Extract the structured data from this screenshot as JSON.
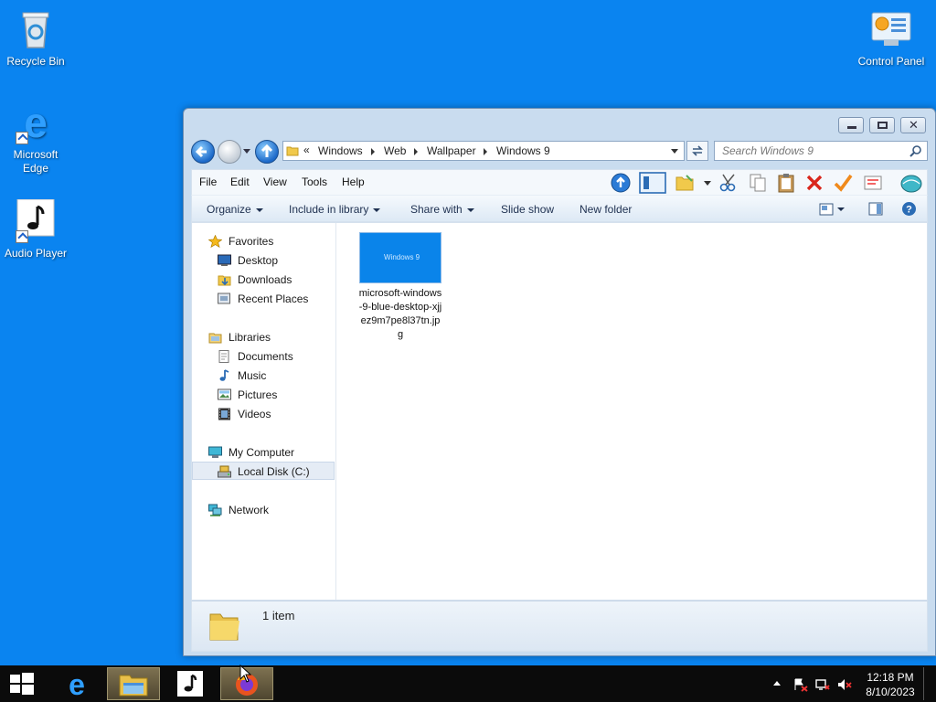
{
  "desktop": {
    "icons": [
      {
        "label": "Recycle Bin"
      },
      {
        "label": "Microsoft Edge"
      },
      {
        "label": "Audio Player"
      },
      {
        "label": "Control Panel"
      }
    ]
  },
  "window": {
    "breadcrumb_prefix": "«",
    "breadcrumbs": [
      "Windows",
      "Web",
      "Wallpaper",
      "Windows 9"
    ],
    "search_placeholder": "Search Windows 9",
    "menu": [
      "File",
      "Edit",
      "View",
      "Tools",
      "Help"
    ],
    "commands": {
      "organize": "Organize",
      "include_in_library": "Include in library",
      "share_with": "Share with",
      "slide_show": "Slide show",
      "new_folder": "New folder"
    },
    "nav_pane": {
      "favorites": "Favorites",
      "favorites_items": [
        "Desktop",
        "Downloads",
        "Recent Places"
      ],
      "libraries": "Libraries",
      "libraries_items": [
        "Documents",
        "Music",
        "Pictures",
        "Videos"
      ],
      "my_computer": "My Computer",
      "local_disk": "Local Disk (C:)",
      "network": "Network"
    },
    "file": {
      "name": "microsoft-windows-9-blue-desktop-xjjez9m7pe8l37tn.jpg",
      "thumb_text": "Windows 9"
    },
    "details": {
      "item_count": "1 item"
    }
  },
  "taskbar": {
    "time": "12:18 PM",
    "date": "8/10/2023"
  },
  "colors": {
    "desktop": "#0a84f0",
    "window_frame": "#c9dcef",
    "taskbar": "#0b0b0b"
  }
}
